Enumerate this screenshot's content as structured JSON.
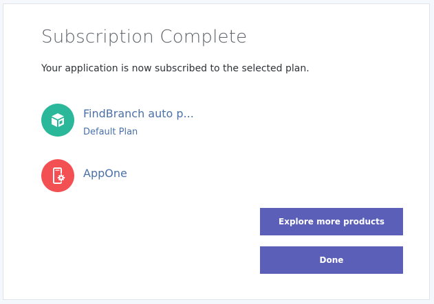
{
  "dialog": {
    "title": "Subscription Complete",
    "message": "Your application is now subscribed to the selected plan."
  },
  "product": {
    "name": "FindBranch auto p...",
    "plan": "Default Plan",
    "icon": "package-icon",
    "icon_color": "#2bb79a"
  },
  "application": {
    "name": "AppOne",
    "icon": "mobile-app-gear-icon",
    "icon_color": "#f25052"
  },
  "buttons": {
    "explore_label": "Explore more products",
    "done_label": "Done",
    "color": "#5b5fb8"
  },
  "colors": {
    "link_text": "#4a70a8",
    "title_text": "#5b6068"
  }
}
